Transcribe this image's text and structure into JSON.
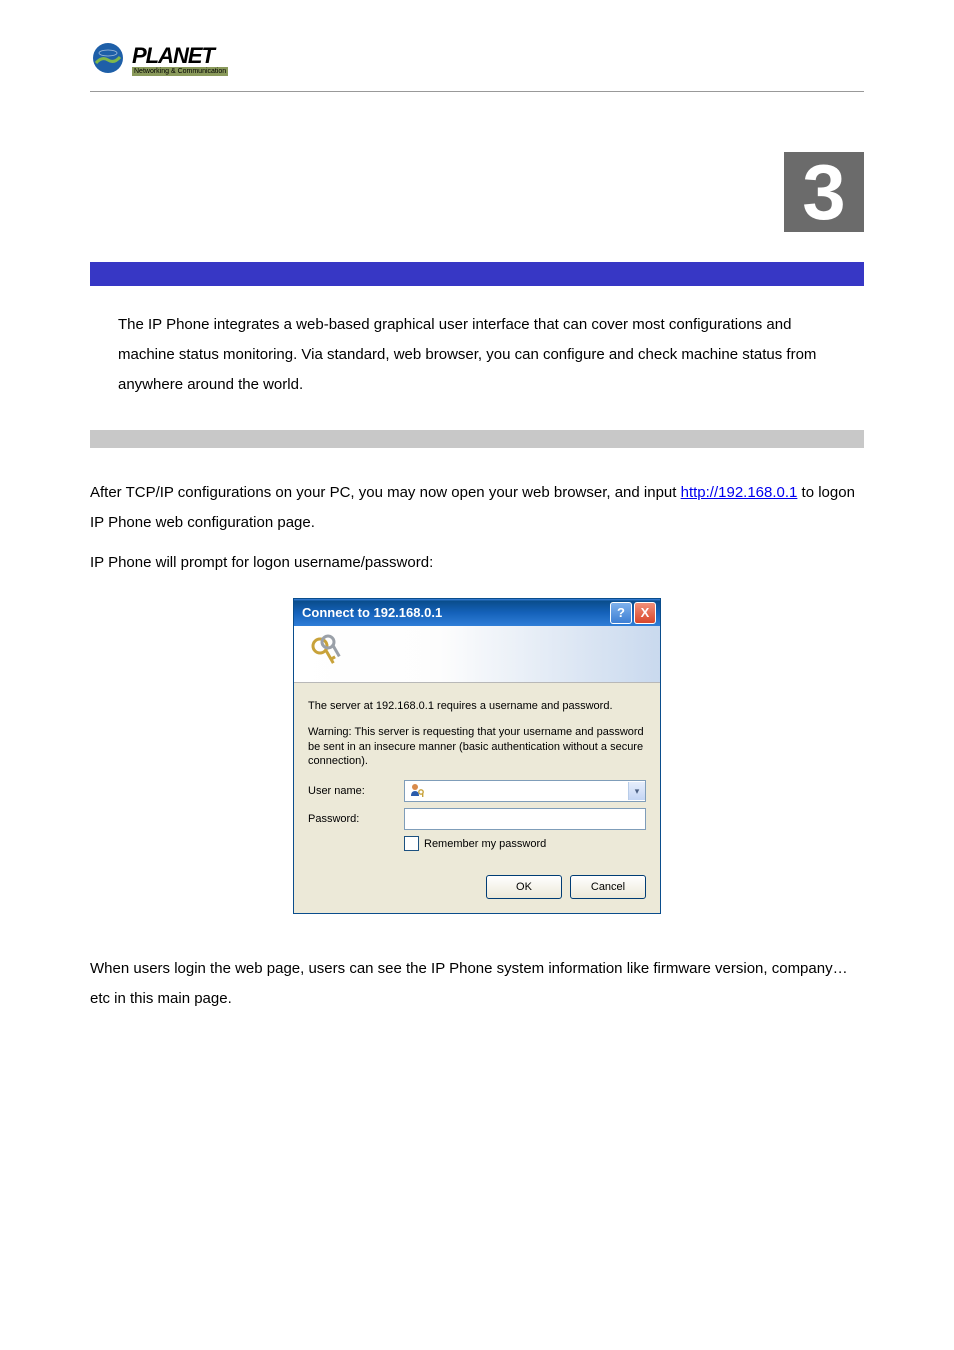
{
  "logo": {
    "brand": "PLANET",
    "tagline": "Networking & Communication"
  },
  "chapter_number": "3",
  "intro": "The IP Phone integrates a web-based graphical user interface that can cover most configurations and machine status monitoring. Via standard, web browser, you can configure and check machine status from anywhere around the world.",
  "body": {
    "p1_before_link": "After TCP/IP configurations on your PC, you may now open your web browser, and input ",
    "link_text": "http://192.168.0.1",
    "p1_after_link": " to logon IP Phone web configuration page.",
    "p2": "IP Phone will prompt for logon username/password:"
  },
  "dialog": {
    "title": "Connect to 192.168.0.1",
    "help_glyph": "?",
    "close_glyph": "X",
    "message1": "The server at 192.168.0.1 requires a username and password.",
    "message2": "Warning: This server is requesting that your username and password be sent in an insecure manner (basic authentication without a secure connection).",
    "username_label": "User name:",
    "password_label": "Password:",
    "remember_label": "Remember my password",
    "ok": "OK",
    "cancel": "Cancel"
  },
  "footer": "When users login the web page, users can see the IP Phone system information like firmware version, company…etc in this main page."
}
